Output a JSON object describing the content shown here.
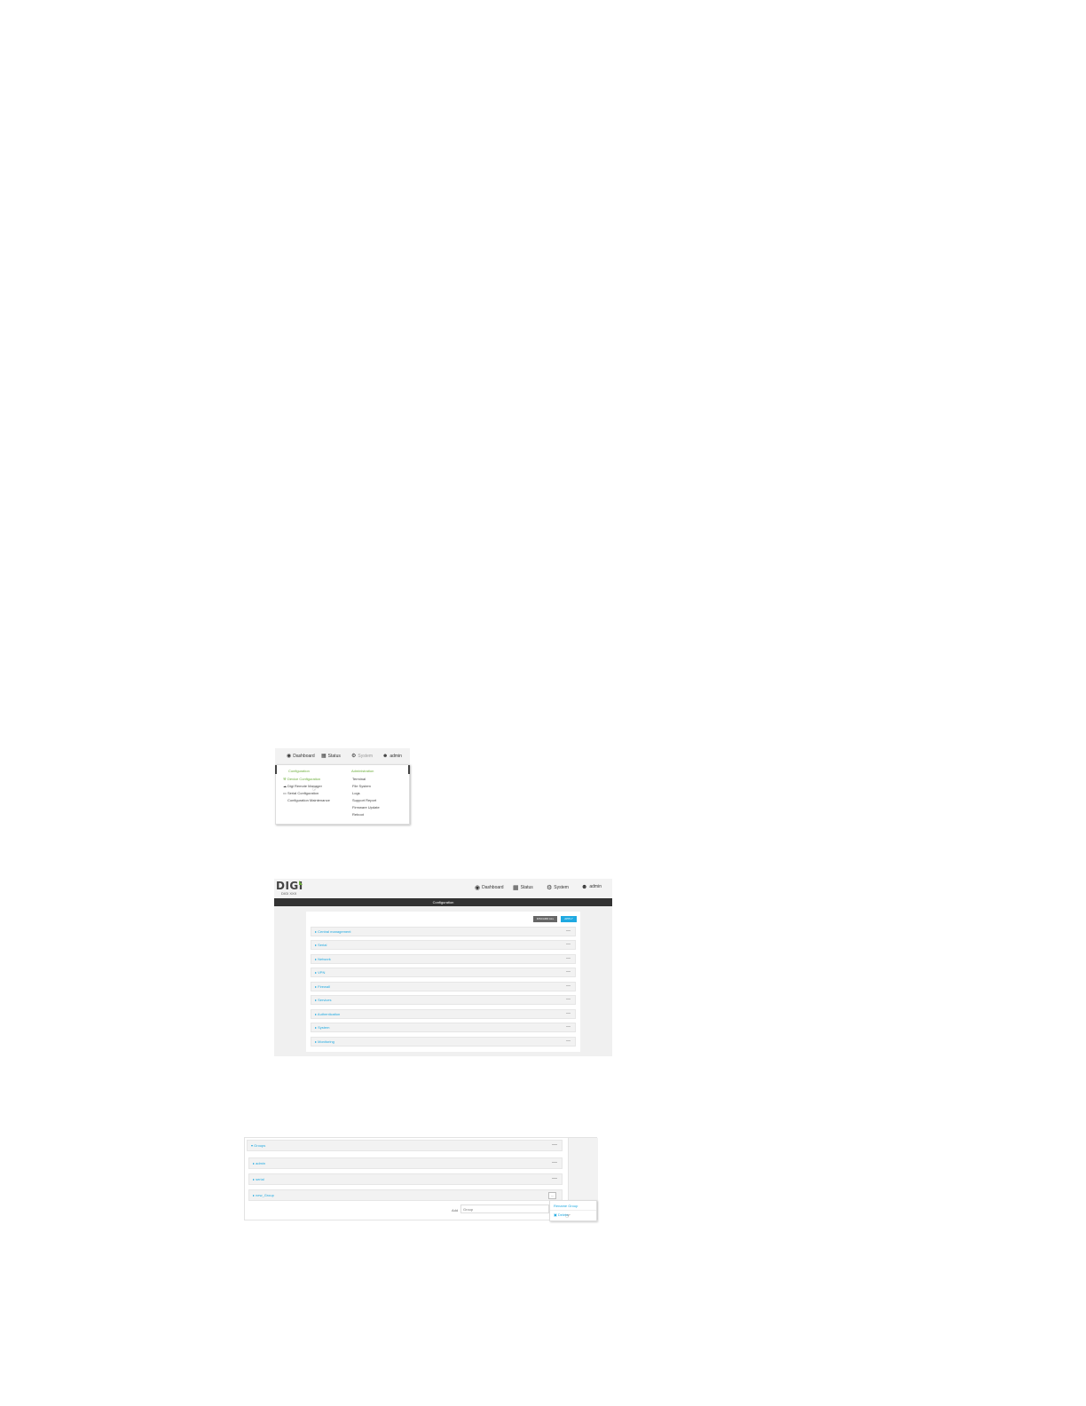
{
  "system_menu": {
    "nav": {
      "dashboard": "Dashboard",
      "status": "Status",
      "system": "System",
      "user": "admin"
    },
    "configuration": {
      "heading": "Configuration",
      "items": [
        "Device Configuration",
        "Digi Remote Manager",
        "Serial Configuration",
        "Configuration Maintenance"
      ]
    },
    "administration": {
      "heading": "Administration",
      "items": [
        "Terminal",
        "File System",
        "Logs",
        "Support Report",
        "Firmware Update",
        "Reboot"
      ]
    },
    "icons": [
      "dashboard-icon",
      "status-grid-icon",
      "gear-icon",
      "user-icon",
      "wrench-icon",
      "cloud-icon",
      "serial-icon"
    ]
  },
  "config_page": {
    "logo": "DIGI",
    "tagline": "DIGI XXX",
    "nav": {
      "dashboard": "Dashboard",
      "status": "Status",
      "system": "System",
      "user": "admin"
    },
    "title": "Configuration",
    "discard_label": "DISCARD ALL",
    "apply_label": "APPLY",
    "sections": [
      "Central management",
      "Serial",
      "Network",
      "VPN",
      "Firewall",
      "Services",
      "Authentication",
      "System",
      "Monitoring"
    ],
    "accent_color": "#1fa9e1",
    "brand_color": "#6dae3b"
  },
  "groups_panel": {
    "heading": "Groups",
    "groups": [
      "admin",
      "serial",
      "new_Group"
    ],
    "add_label": "Add",
    "add_placeholder": "Group",
    "menu_button": "...",
    "context_menu": [
      "Rename Group",
      "Delete"
    ]
  }
}
